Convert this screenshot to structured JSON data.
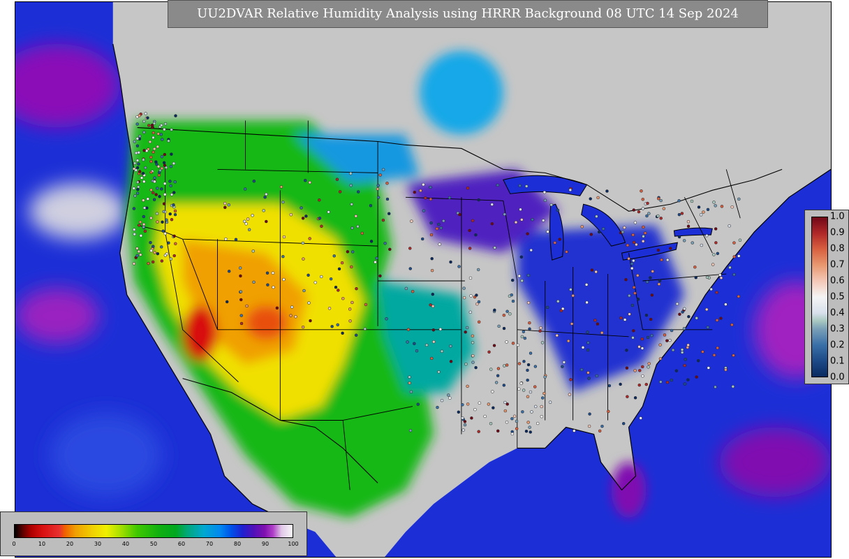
{
  "title": "UU2DVAR Relative Humidity Analysis using HRRR Background 08 UTC 14 Sep 2024",
  "colors": {
    "ocean": "#1c2fd6",
    "land_gray": "#c8c8c8",
    "dry_yellow": "#f0e000",
    "dry_orange": "#f07800",
    "dry_red": "#d01010",
    "green": "#18b818",
    "cyan": "#18a8e8",
    "purple": "#7a10b0",
    "magenta": "#a020c0"
  },
  "rh_colorbar": {
    "min": 0,
    "max": 100,
    "tick_labels": [
      "0",
      "10",
      "20",
      "30",
      "40",
      "50",
      "60",
      "70",
      "80",
      "90",
      "100"
    ],
    "stops": [
      {
        "value": 0,
        "color": "#000000"
      },
      {
        "value": 3,
        "color": "#600000"
      },
      {
        "value": 6,
        "color": "#b00000"
      },
      {
        "value": 10,
        "color": "#d81010"
      },
      {
        "value": 16,
        "color": "#e83030"
      },
      {
        "value": 18,
        "color": "#f06000"
      },
      {
        "value": 22,
        "color": "#f0a000"
      },
      {
        "value": 28,
        "color": "#f0d000"
      },
      {
        "value": 33,
        "color": "#f0f000"
      },
      {
        "value": 38,
        "color": "#a8e000"
      },
      {
        "value": 44,
        "color": "#40c800"
      },
      {
        "value": 52,
        "color": "#10b010"
      },
      {
        "value": 58,
        "color": "#00a820"
      },
      {
        "value": 62,
        "color": "#00a878"
      },
      {
        "value": 68,
        "color": "#00a8d0"
      },
      {
        "value": 74,
        "color": "#0088f0"
      },
      {
        "value": 78,
        "color": "#0050e8"
      },
      {
        "value": 82,
        "color": "#2020d0"
      },
      {
        "value": 86,
        "color": "#5010b8"
      },
      {
        "value": 90,
        "color": "#8010b0"
      },
      {
        "value": 93,
        "color": "#b040c8"
      },
      {
        "value": 96,
        "color": "#e0c8e8"
      },
      {
        "value": 100,
        "color": "#f8f8f8"
      }
    ]
  },
  "obs_colorbar": {
    "min": 0.0,
    "max": 1.0,
    "tick_labels": [
      "1.0",
      "0.9",
      "0.8",
      "0.7",
      "0.6",
      "0.5",
      "0.4",
      "0.3",
      "0.2",
      "0.1",
      "0.0"
    ],
    "stops": [
      {
        "value": 0.0,
        "color": "#0a2a60"
      },
      {
        "value": 0.1,
        "color": "#1d4a88"
      },
      {
        "value": 0.2,
        "color": "#3a70a8"
      },
      {
        "value": 0.3,
        "color": "#7aa0b8"
      },
      {
        "value": 0.35,
        "color": "#a8c8c0"
      },
      {
        "value": 0.4,
        "color": "#d8e0ec"
      },
      {
        "value": 0.5,
        "color": "#f4f4f4"
      },
      {
        "value": 0.6,
        "color": "#f4c8b8"
      },
      {
        "value": 0.7,
        "color": "#e89870"
      },
      {
        "value": 0.8,
        "color": "#d86040"
      },
      {
        "value": 0.9,
        "color": "#b02828"
      },
      {
        "value": 1.0,
        "color": "#700818"
      }
    ]
  }
}
